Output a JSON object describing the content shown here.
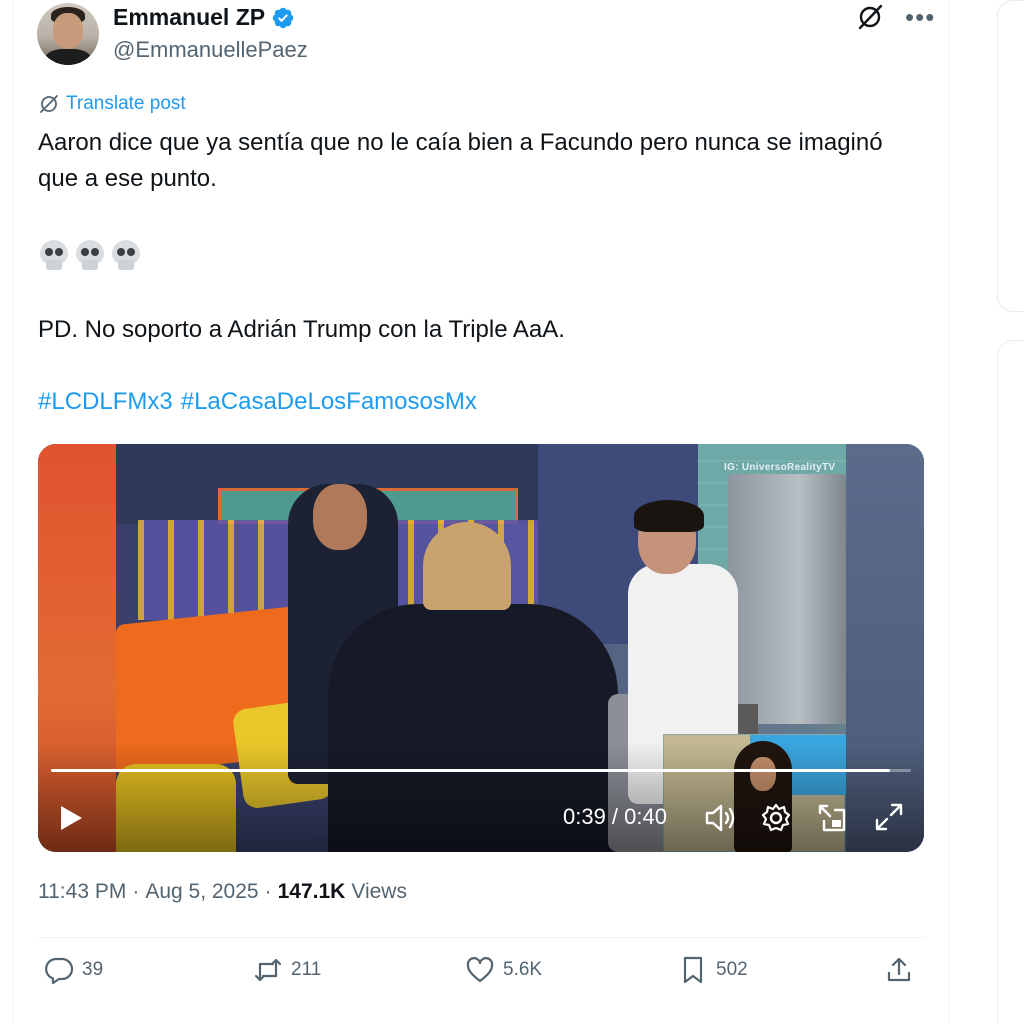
{
  "author": {
    "display_name": "Emmanuel ZP",
    "handle": "@EmmanuellePaez",
    "verified": true
  },
  "header_icons": [
    "grok-icon",
    "more-icon"
  ],
  "translate_label": "Translate post",
  "tweet": {
    "line1": "Aaron dice que ya sentía que no le caía bien a Facundo pero nunca se imaginó que a ese punto.",
    "emojis": [
      "skull",
      "skull",
      "skull"
    ],
    "line2": "PD. No soporto a Adrián Trump con la Triple AaA.",
    "hashtags": [
      "#LCDLFMx3",
      "#LaCasaDeLosFamososMx"
    ]
  },
  "video": {
    "watermark": "IG: UniversoRealityTV",
    "time": "0:39 / 0:40",
    "progress": 0.975
  },
  "meta": {
    "time": "11:43 PM",
    "date": "Aug 5, 2025",
    "views_count": "147.1K",
    "views_label": "Views",
    "sep": "·"
  },
  "actions": {
    "replies": "39",
    "reposts": "211",
    "likes": "5.6K",
    "bookmarks": "502"
  },
  "colors": {
    "accent": "#1d9bf0",
    "text": "#0f1419",
    "secondary": "#536471"
  }
}
